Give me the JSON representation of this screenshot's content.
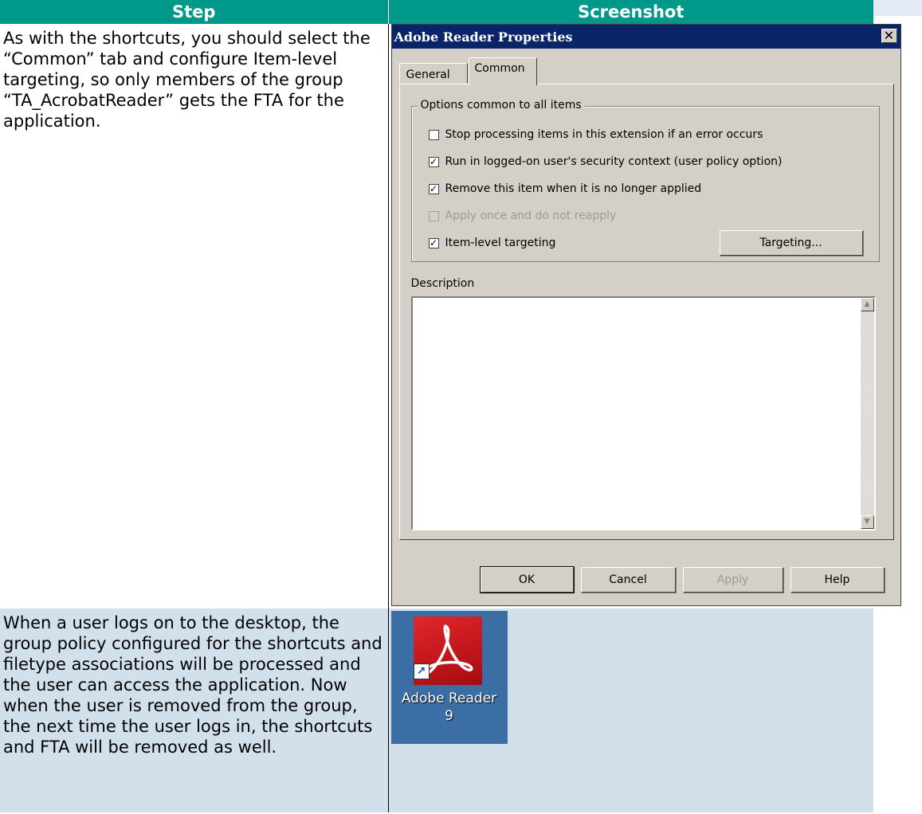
{
  "table": {
    "headers": {
      "step": "Step",
      "screenshot": "Screenshot"
    },
    "rows": [
      {
        "step_text": "As with the shortcuts, you should select the “Common” tab and configure Item-level targeting, so only members of the group “TA_AcrobatReader” gets the FTA for the application."
      },
      {
        "step_text": "When a user logs on to the desktop, the group policy configured for the shortcuts and filetype associations will be processed and the user can access the application. Now when the user is removed from the group, the next time the user logs in, the shortcuts and FTA will be removed as well."
      }
    ]
  },
  "dialog": {
    "title": "Adobe Reader Properties",
    "close_glyph": "✕",
    "tabs": [
      {
        "label": "General",
        "selected": false
      },
      {
        "label": "Common",
        "selected": true
      }
    ],
    "group_label": "Options common to all items",
    "options": [
      {
        "label": "Stop processing items in this extension if an error occurs",
        "checked": false,
        "enabled": true,
        "mark": ""
      },
      {
        "label": "Run in logged-on user's security context (user policy option)",
        "checked": true,
        "enabled": true,
        "mark": "✓"
      },
      {
        "label": "Remove this item when it is no longer applied",
        "checked": true,
        "enabled": true,
        "mark": "✓"
      },
      {
        "label": "Apply once and do not reapply",
        "checked": false,
        "enabled": false,
        "mark": ""
      },
      {
        "label": "Item-level targeting",
        "checked": true,
        "enabled": true,
        "mark": "✓"
      }
    ],
    "targeting_button": "Targeting...",
    "description_label": "Description",
    "description_value": "",
    "buttons": {
      "ok": "OK",
      "cancel": "Cancel",
      "apply": "Apply",
      "help": "Help"
    }
  },
  "desktop_icon": {
    "label_line1": "Adobe Reader",
    "label_line2": "9",
    "background_color": "#3a6ea5",
    "icon": "adobe-reader-icon",
    "overlay": "shortcut-arrow-icon"
  },
  "colors": {
    "header": "#009889",
    "row2_background": "#d2e0ec",
    "titlebar": "#0a246a"
  }
}
